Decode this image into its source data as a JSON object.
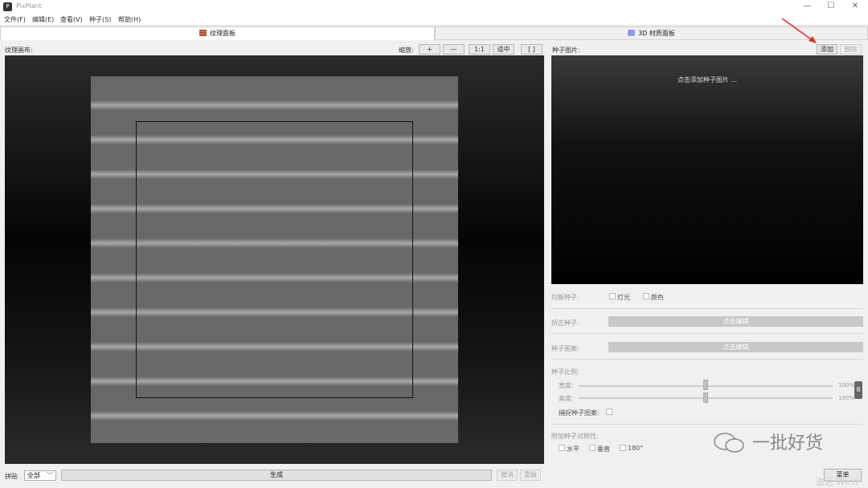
{
  "app": {
    "title": "PixPlant",
    "icon": "pixplant-logo-icon"
  },
  "window_controls": {
    "minimize": "—",
    "maximize": "☐",
    "close": "✕"
  },
  "menu": [
    "文件(F)",
    "编辑(E)",
    "查看(V)",
    "种子(S)",
    "帮助(H)"
  ],
  "tabs": [
    {
      "label": "纹理面板",
      "icon": "texture-panel-icon",
      "active": true
    },
    {
      "label": "3D 材质面板",
      "icon": "3d-cube-icon",
      "active": false
    }
  ],
  "left": {
    "canvas_label": "纹理画布:",
    "zoom_label": "缩放:",
    "zoom_buttons": [
      "+",
      "—",
      "1:1",
      "适中",
      "[ ]"
    ]
  },
  "bottom": {
    "tile_label": "拼贴",
    "tile_value": "全部",
    "generate": "生成",
    "undo": "撤消",
    "redo": "重做"
  },
  "right": {
    "seed_image_label": "种子图片:",
    "add_button": "添加",
    "delete_button": "删除",
    "preview_hint": "点击添加种子图片 ...",
    "balance_label": "均衡种子:",
    "light_label": "灯光",
    "color_label": "颜色",
    "straighten_label": "矫正种子:",
    "straighten_edit": "点击编辑",
    "pattern_label": "种子图案:",
    "pattern_edit": "点击编辑",
    "scale_label": "种子比例:",
    "width_label": "宽度:",
    "width_pct": "100%",
    "height_label": "高度:",
    "height_pct": "100%",
    "capture_label": "捕捉种子图案:",
    "symmetry_label": "附加种子对称性:",
    "horizontal_label": "水平",
    "vertical_label": "垂直",
    "rotate_label": "180°",
    "menu_button": "菜单"
  },
  "watermark": {
    "text": "一批好货",
    "partial": "激活 Wind"
  },
  "colors": {
    "accent_arrow": "#e0302a",
    "canvas_texture": "#686868"
  }
}
